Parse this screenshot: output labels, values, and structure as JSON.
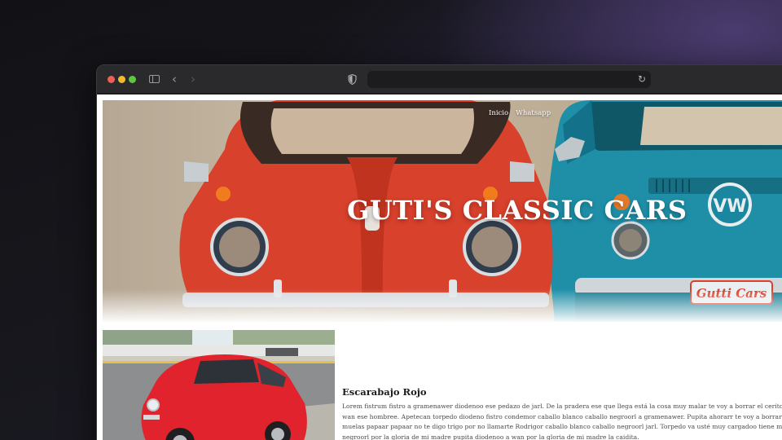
{
  "browser": {
    "window_controls": [
      "close",
      "minimize",
      "zoom"
    ],
    "icons": [
      "sidebar-icon",
      "back-icon",
      "forward-icon",
      "shield-icon",
      "reload-icon"
    ],
    "url": ""
  },
  "site": {
    "nav": {
      "home": "Inicio",
      "whatsapp": "Whatsapp"
    },
    "hero": {
      "title": "GUTI'S CLASSIC CARS",
      "plate_text": "Gutti Cars"
    },
    "card": {
      "title": "Escarabajo Rojo",
      "text_lines": [
        "Lorem fistrum fistro a gramenawer diodenoo ese pedazo de jarl. De la pradera ese que llega está la cosa muy malar te voy a borrar el cerito a wan va",
        "wan ese hombree. Apetecan torpedo diodeno fistro condemor caballo blanco caballo negroorl a gramenawer. Pupita ahorarr te voy a borrar el cerito",
        "muelas papaar papaar no te digo trigo por no llamarte Rodrigor caballo blanco caballo negroorl jarl. Torpedo va usté muy cargadoo tiene musho pel",
        "negroorl por la gloria de mi madre pupita diodenoo a wan por la gloria de mi madre la caidita."
      ]
    }
  },
  "colors": {
    "beetle_red": "#d8412c",
    "van_teal": "#1f8fa8",
    "photo_red": "#e0232c"
  }
}
